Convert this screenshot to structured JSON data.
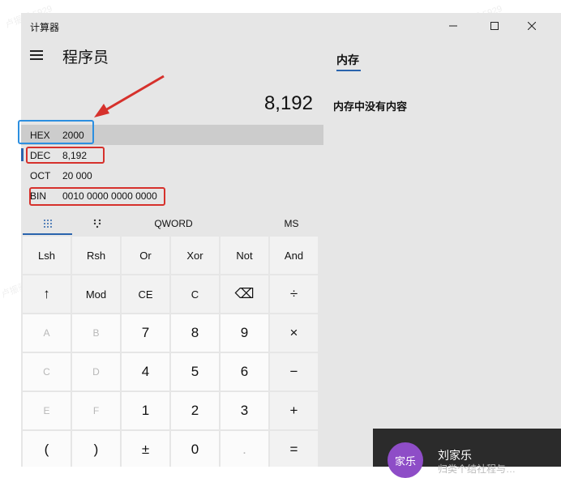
{
  "app_title": "计算器",
  "mode": "程序员",
  "display_value": "8,192",
  "radix": [
    {
      "label": "HEX",
      "value": "2000"
    },
    {
      "label": "DEC",
      "value": "8,192"
    },
    {
      "label": "OCT",
      "value": "20 000"
    },
    {
      "label": "BIN",
      "value": "0010 0000 0000 0000"
    }
  ],
  "tabs": {
    "word_size": "QWORD",
    "memory_store": "MS"
  },
  "keys": [
    [
      "Lsh",
      "Rsh",
      "Or",
      "Xor",
      "Not",
      "And"
    ],
    [
      "↑",
      "Mod",
      "CE",
      "C",
      "⌫",
      "÷"
    ],
    [
      "A",
      "B",
      "7",
      "8",
      "9",
      "×"
    ],
    [
      "C",
      "D",
      "4",
      "5",
      "6",
      "−"
    ],
    [
      "E",
      "F",
      "1",
      "2",
      "3",
      "+"
    ],
    [
      "(",
      ")",
      "±",
      "0",
      ".",
      "="
    ]
  ],
  "memory": {
    "title": "内存",
    "empty_text": "内存中没有内容"
  },
  "notification": {
    "avatar_text": "家乐",
    "name": "刘家乐",
    "sub": "归类个结社程与…"
  },
  "watermark": "卢振驿 5929",
  "colors": {
    "accent": "#2a64ad",
    "annotation_red": "#d6312c",
    "annotation_blue": "#2c8fe0"
  }
}
